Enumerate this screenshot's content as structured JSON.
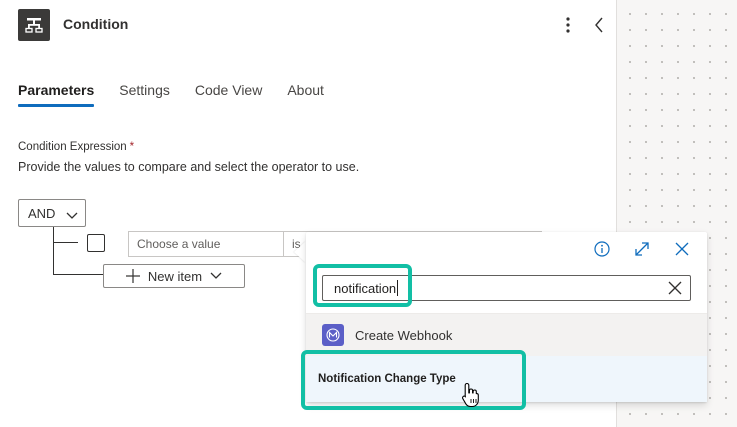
{
  "header": {
    "title": "Condition",
    "icon": "condition-icon",
    "more_icon": "more-vertical-icon",
    "collapse_icon": "chevron-left-icon"
  },
  "tabs": [
    {
      "label": "Parameters",
      "active": true
    },
    {
      "label": "Settings",
      "active": false
    },
    {
      "label": "Code View",
      "active": false
    },
    {
      "label": "About",
      "active": false
    }
  ],
  "condition": {
    "label": "Condition Expression",
    "required_marker": "*",
    "description": "Provide the values to compare and select the operator to use.",
    "group_operator": "AND",
    "row": {
      "value_placeholder": "Choose a value",
      "operator_partial": "is"
    },
    "new_item_label": "New item"
  },
  "popup": {
    "search_value": "notification",
    "items": [
      {
        "label": "Create Webhook",
        "icon": "webhook-icon"
      },
      {
        "label": "Notification Change Type",
        "icon": ""
      }
    ]
  },
  "colors": {
    "accent": "#0f6cbd",
    "highlight": "#12bfa5",
    "webhook_logo": "#5b5fc7"
  }
}
